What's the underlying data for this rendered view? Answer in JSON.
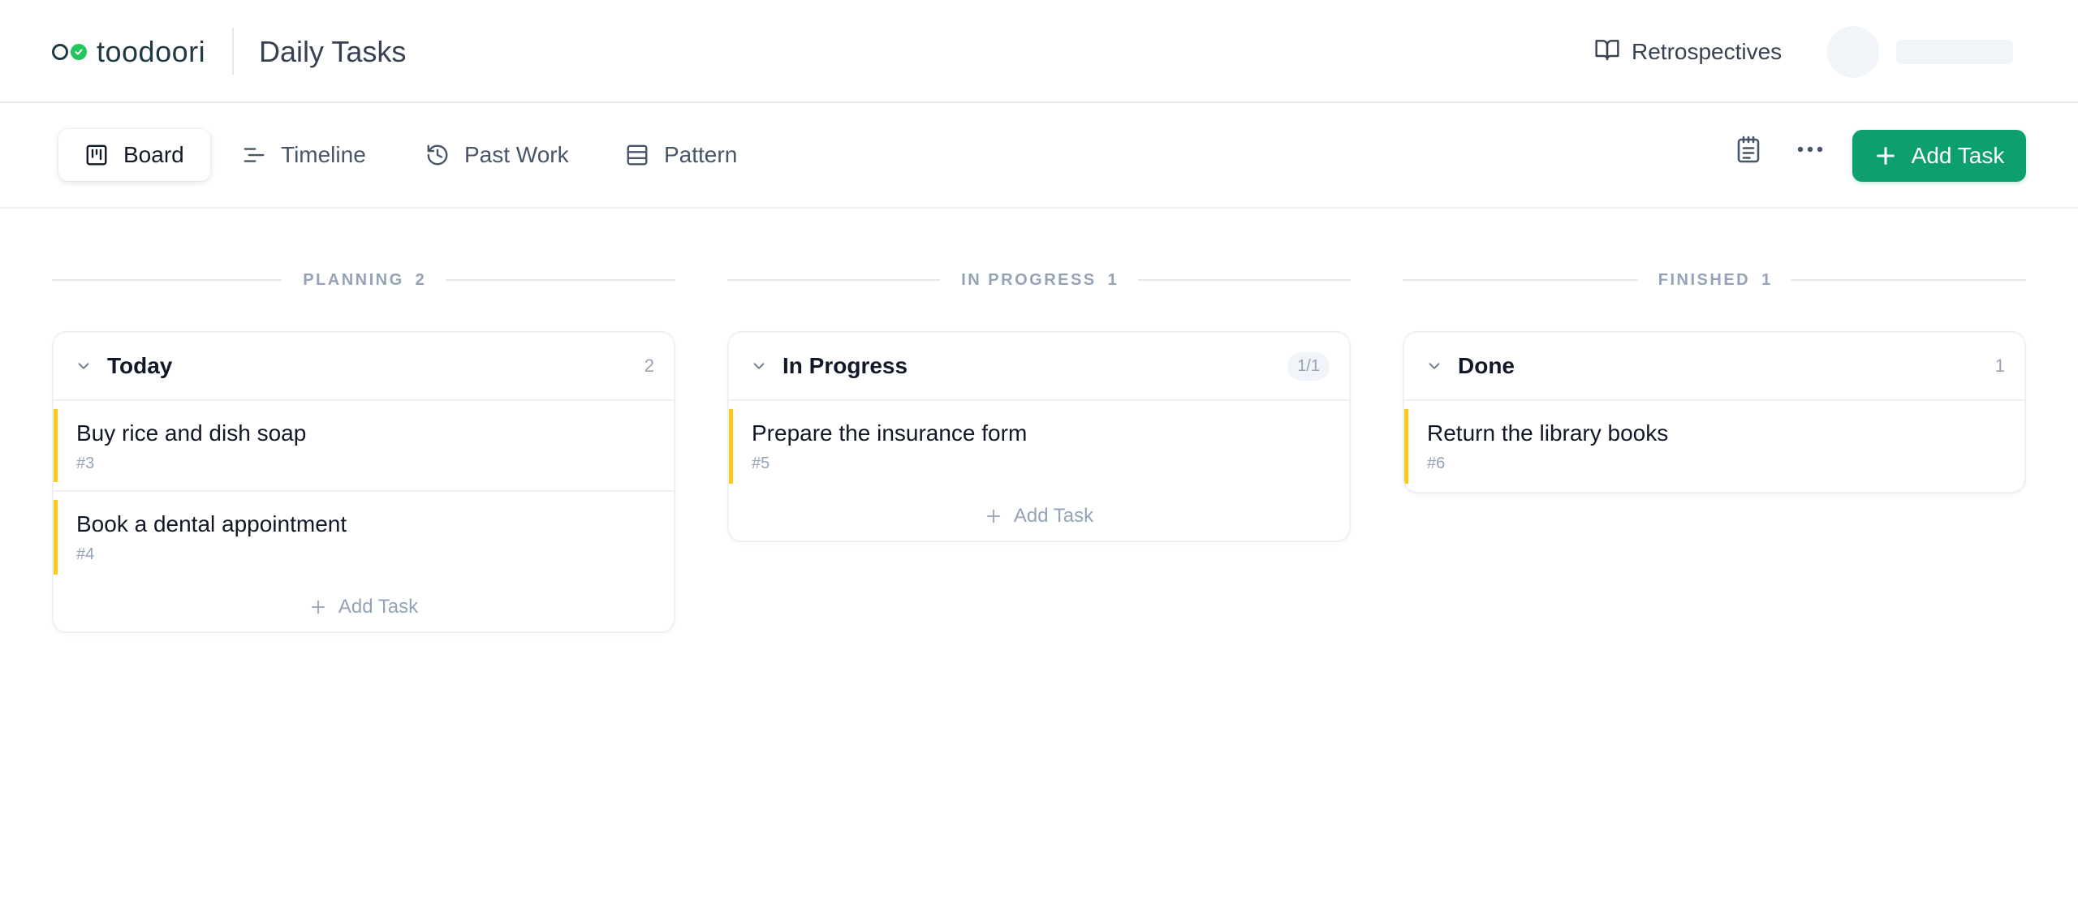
{
  "header": {
    "logo_text": "toodoori",
    "page_title": "Daily Tasks",
    "retrospectives_label": "Retrospectives"
  },
  "toolbar": {
    "tabs": [
      {
        "label": "Board",
        "icon": "board-icon",
        "active": true
      },
      {
        "label": "Timeline",
        "icon": "timeline-icon",
        "active": false
      },
      {
        "label": "Past Work",
        "icon": "history-icon",
        "active": false
      },
      {
        "label": "Pattern",
        "icon": "table-icon",
        "active": false
      }
    ],
    "add_task_label": "Add Task",
    "accent_color": "#0e9f6e"
  },
  "groups": [
    {
      "label": "PLANNING",
      "count": "2"
    },
    {
      "label": "IN PROGRESS",
      "count": "1"
    },
    {
      "label": "FINISHED",
      "count": "1"
    }
  ],
  "columns": [
    {
      "title": "Today",
      "count": "2",
      "tasks": [
        {
          "title": "Buy rice and dish soap",
          "id": "#3"
        },
        {
          "title": "Book a dental appointment",
          "id": "#4"
        }
      ],
      "add_label": "Add Task"
    },
    {
      "title": "In Progress",
      "count": "1/1",
      "tasks": [
        {
          "title": "Prepare the insurance form",
          "id": "#5"
        }
      ],
      "add_label": "Add Task"
    },
    {
      "title": "Done",
      "count": "1",
      "tasks": [
        {
          "title": "Return the library books",
          "id": "#6"
        }
      ]
    }
  ],
  "task_accent_color": "#facc15"
}
